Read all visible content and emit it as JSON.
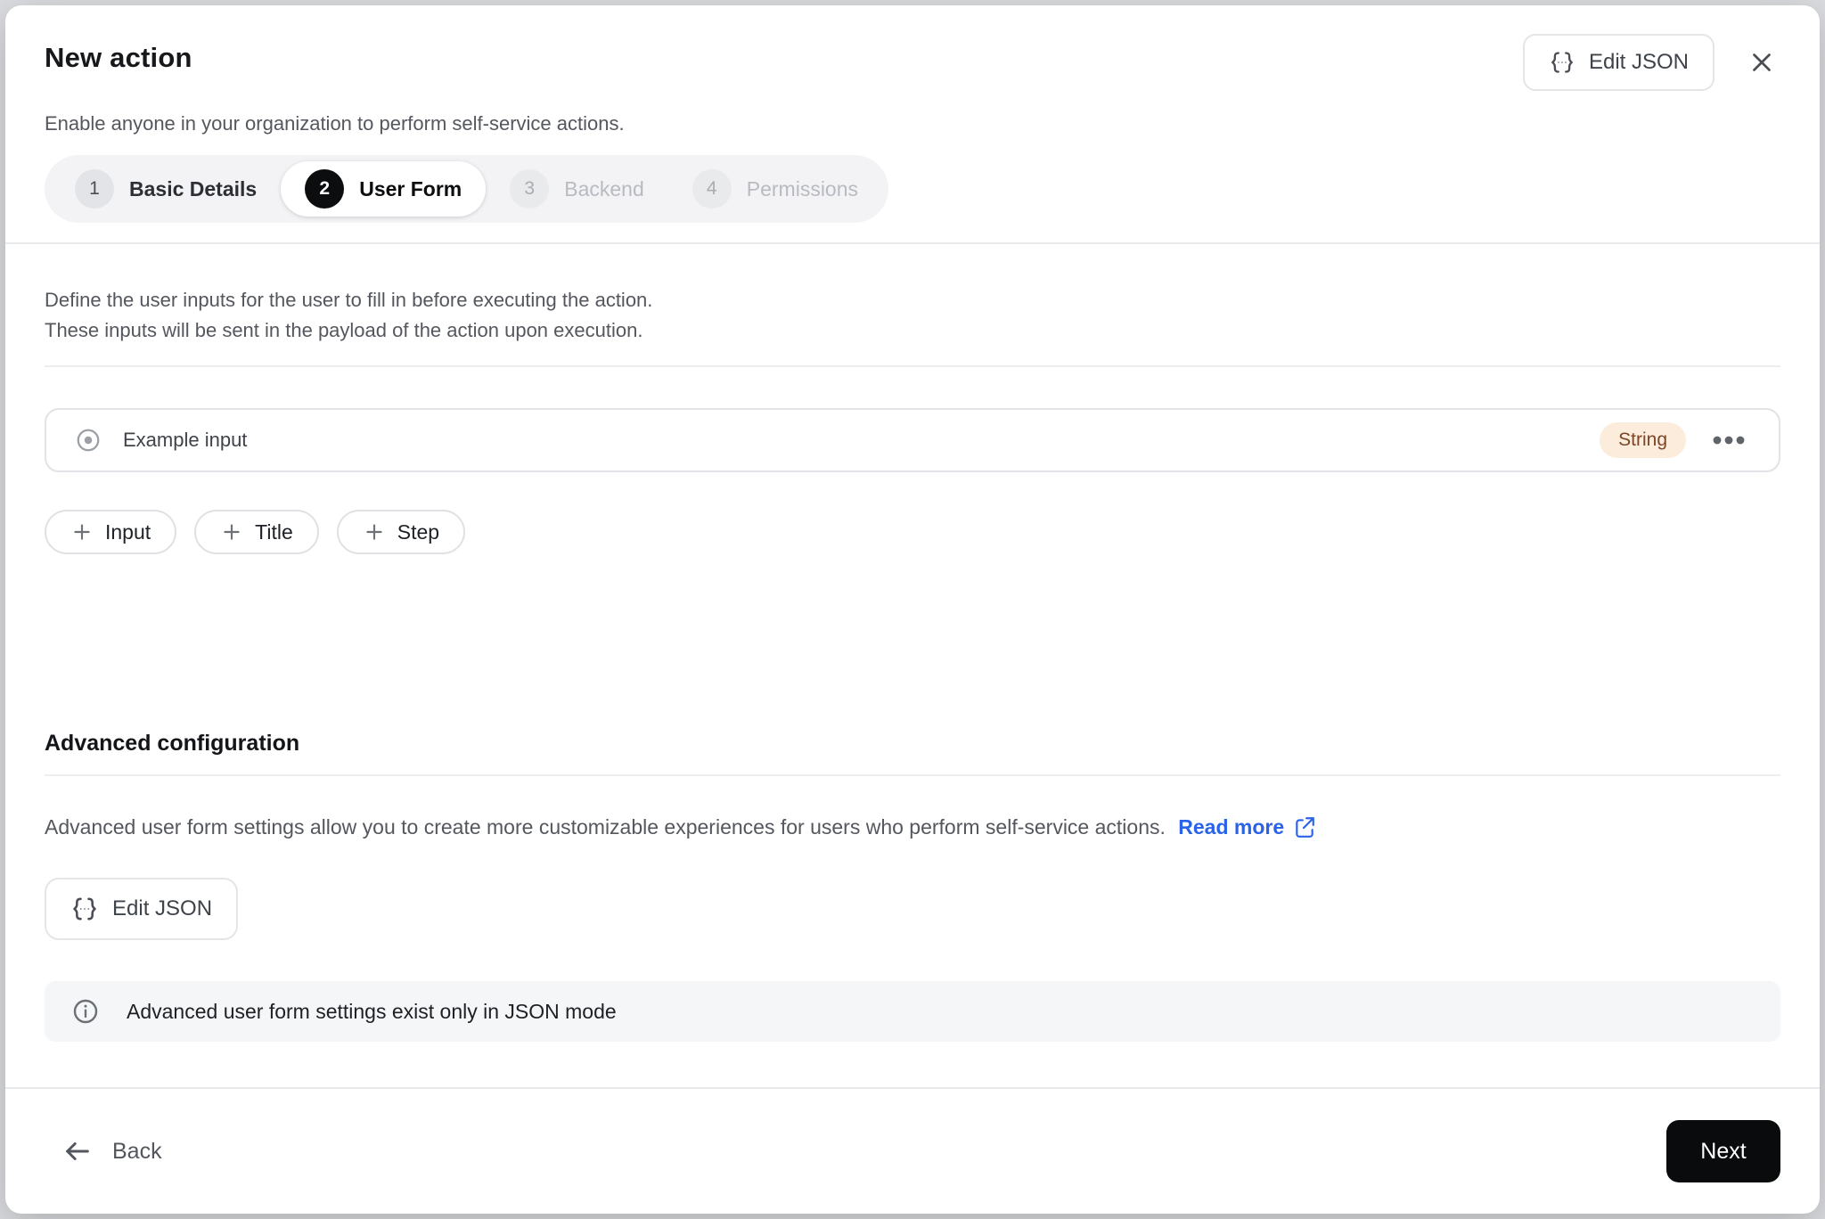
{
  "modal": {
    "title": "New action",
    "subtitle": "Enable anyone in your organization to perform self-service actions.",
    "header_edit_json_label": "Edit JSON"
  },
  "stepper": {
    "steps": [
      {
        "number": "1",
        "label": "Basic Details",
        "state": "completed"
      },
      {
        "number": "2",
        "label": "User Form",
        "state": "active"
      },
      {
        "number": "3",
        "label": "Backend",
        "state": "upcoming"
      },
      {
        "number": "4",
        "label": "Permissions",
        "state": "upcoming"
      }
    ]
  },
  "form_section": {
    "description_line1": "Define the user inputs for the user to fill in before executing the action.",
    "description_line2": "These inputs will be sent in the payload of the action upon execution.",
    "inputs": [
      {
        "label": "Example input",
        "type_badge": "String"
      }
    ],
    "add_buttons": [
      {
        "label": "Input"
      },
      {
        "label": "Title"
      },
      {
        "label": "Step"
      }
    ]
  },
  "advanced": {
    "heading": "Advanced configuration",
    "description": "Advanced user form settings allow you to create more customizable experiences for users who perform self-service actions.",
    "read_more_label": "Read more",
    "edit_json_label": "Edit JSON",
    "info_banner": "Advanced user form settings exist only in JSON mode"
  },
  "footer": {
    "back_label": "Back",
    "next_label": "Next"
  },
  "icons": {
    "edit_json": "braces-ellipsis-icon",
    "close": "close-icon",
    "input_row": "radio-icon",
    "row_menu": "ellipsis-icon",
    "add": "plus-icon",
    "read_more": "external-link-icon",
    "info": "info-circle-icon",
    "back": "arrow-left-icon"
  },
  "colors": {
    "badge_bg": "#fcecdc",
    "badge_text": "#7d4526",
    "link_blue": "#2a62e9",
    "active_step": "#0c0d0f",
    "next_button": "#0a0b0d",
    "stepper_bg": "#f3f3f5",
    "banner_bg": "#f5f6f8"
  }
}
